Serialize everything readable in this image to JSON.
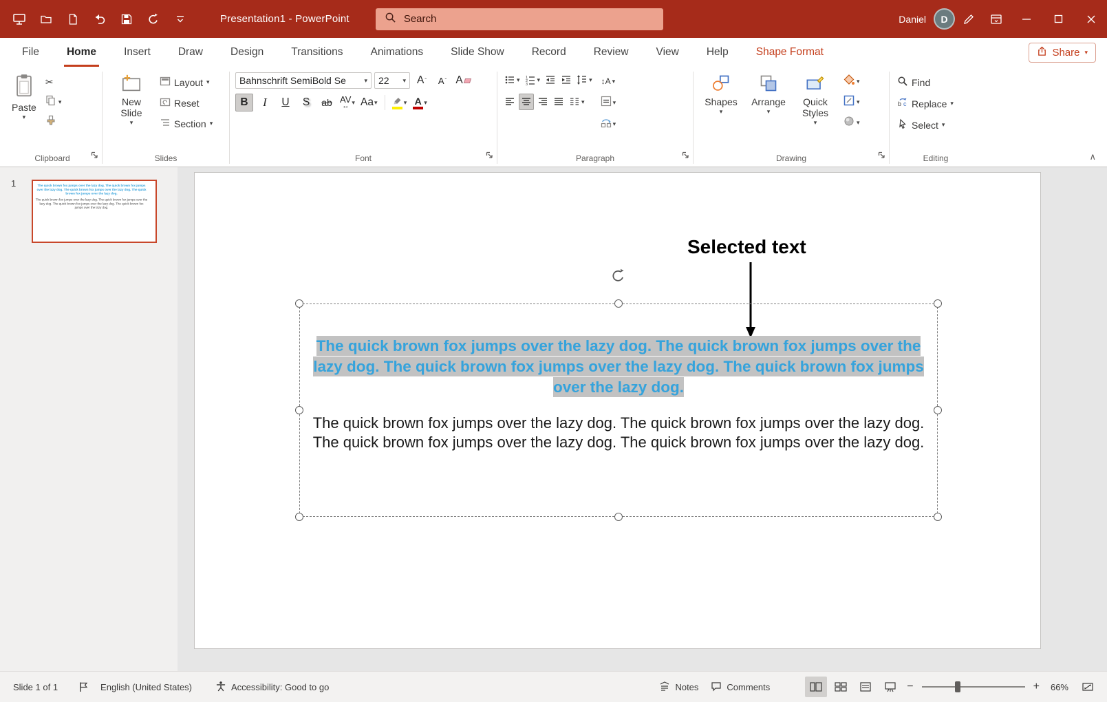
{
  "titlebar": {
    "title": "Presentation1  -  PowerPoint",
    "search_placeholder": "Search",
    "user_name": "Daniel",
    "avatar_initial": "D"
  },
  "tabs": {
    "items": [
      "File",
      "Home",
      "Insert",
      "Draw",
      "Design",
      "Transitions",
      "Animations",
      "Slide Show",
      "Record",
      "Review",
      "View",
      "Help",
      "Shape Format"
    ],
    "active_tab": "Home",
    "share_label": "Share"
  },
  "ribbon": {
    "clipboard": {
      "group_label": "Clipboard",
      "paste_label": "Paste"
    },
    "slides": {
      "group_label": "Slides",
      "new_slide_label": "New Slide",
      "layout_label": "Layout",
      "reset_label": "Reset",
      "section_label": "Section"
    },
    "font": {
      "group_label": "Font",
      "family": "Bahnschrift SemiBold Se",
      "size": "22",
      "bold": "B",
      "italic": "I",
      "underline": "U",
      "shadow": "S",
      "strikethrough": "ab",
      "char_spacing": "AV",
      "change_case": "Aa",
      "grow": "A",
      "shrink": "A",
      "clear": "A",
      "color_letter": "A"
    },
    "paragraph": {
      "group_label": "Paragraph"
    },
    "drawing": {
      "group_label": "Drawing",
      "shapes_label": "Shapes",
      "arrange_label": "Arrange",
      "quick_styles_label": "Quick Styles"
    },
    "editing": {
      "group_label": "Editing",
      "find_label": "Find",
      "replace_label": "Replace",
      "select_label": "Select"
    }
  },
  "slide_panel": {
    "slide_number": "1"
  },
  "canvas": {
    "annotation": "Selected text",
    "highlighted_paragraph": "The quick brown fox jumps over the lazy dog. The quick brown fox jumps over the lazy dog. The quick brown fox jumps over the lazy dog. The quick brown fox jumps over the lazy dog.",
    "body_paragraph": "The quick brown fox jumps over the lazy dog. The quick brown fox jumps over the lazy dog. The quick brown fox jumps over the lazy dog. The quick brown fox jumps over the lazy dog."
  },
  "statusbar": {
    "slide_indicator": "Slide 1 of 1",
    "language": "English (United States)",
    "accessibility": "Accessibility: Good to go",
    "notes_label": "Notes",
    "comments_label": "Comments",
    "zoom_value": "66%"
  },
  "icons": {
    "cut": "✂",
    "dropdown": "▾",
    "collapse_ribbon": "∧",
    "caret_up": "ˆ",
    "caret_down": "ˇ",
    "arrow_lr": "↔",
    "text_direction": "↕A",
    "zoom_out": "−",
    "zoom_in": "+"
  },
  "colors": {
    "titlebar_red": "#A62B1A",
    "accent_red": "#C43E1C",
    "selection_blue": "#35A3DC",
    "highlight_gray": "#C2C2C2",
    "thumbnail_border": "#C8472A"
  }
}
